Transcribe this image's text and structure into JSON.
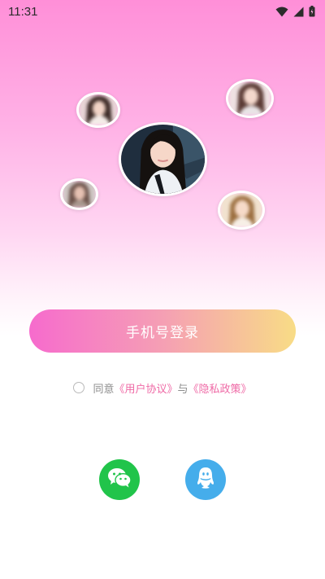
{
  "status_bar": {
    "time": "11:31",
    "icons": [
      "wifi-icon",
      "signal-icon",
      "battery-icon"
    ]
  },
  "avatars": [
    {
      "name": "avatar-main",
      "style": "clear"
    },
    {
      "name": "avatar-top-left",
      "style": "blurred"
    },
    {
      "name": "avatar-top-right",
      "style": "blurred"
    },
    {
      "name": "avatar-mid-left",
      "style": "blurred"
    },
    {
      "name": "avatar-bottom-right",
      "style": "blurred"
    }
  ],
  "login": {
    "phone_button_label": "手机号登录"
  },
  "agreement": {
    "prefix": "同意",
    "user_agreement": "《用户协议》",
    "conjunction": "与",
    "privacy_policy": "《隐私政策》",
    "checked": false
  },
  "social_login": [
    {
      "name": "wechat-login",
      "icon": "wechat-icon",
      "color": "#21c44a"
    },
    {
      "name": "qq-login",
      "icon": "qq-icon",
      "color": "#45adeb"
    }
  ],
  "colors": {
    "accent_pink": "#ef6aa6",
    "button_gradient": [
      "#f66bcd",
      "#f59fb4",
      "#f8dc86"
    ],
    "background_top": "#ff8fd8"
  }
}
